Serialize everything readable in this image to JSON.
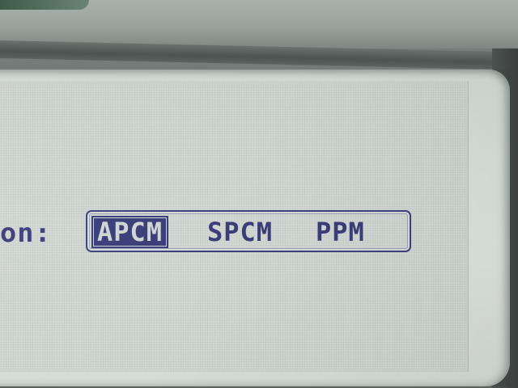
{
  "screen": {
    "field_label": "on:",
    "options": [
      {
        "label": "APCM",
        "selected": true
      },
      {
        "label": "SPCM",
        "selected": false
      },
      {
        "label": "PPM",
        "selected": false
      }
    ]
  },
  "colors": {
    "lcd_background": "#d2d8d4",
    "lcd_text": "#3a3d78",
    "selection_fill": "#3a3d78"
  }
}
